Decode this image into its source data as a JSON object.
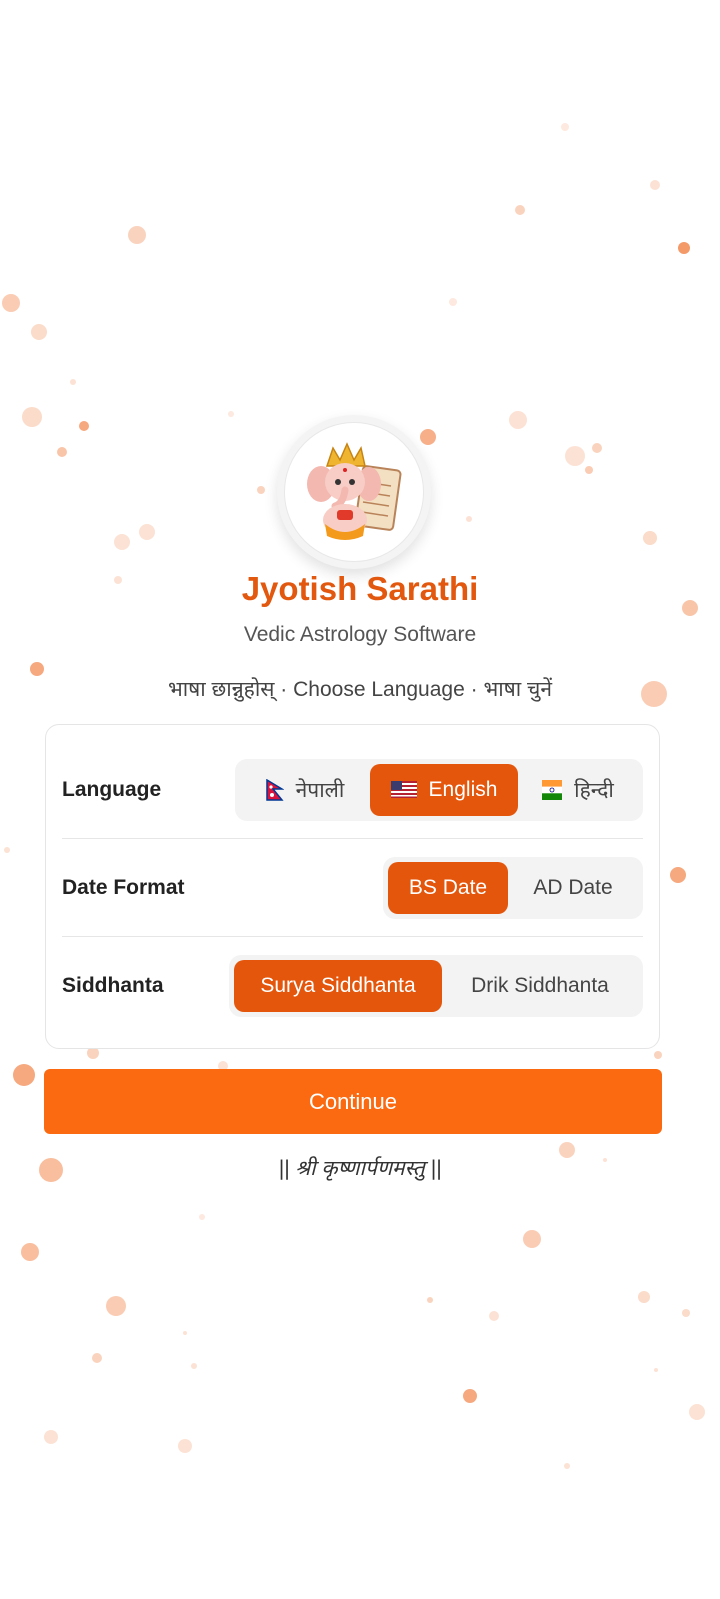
{
  "app": {
    "title": "Jyotish Sarathi",
    "subtitle": "Vedic Astrology Software",
    "choose_language": "भाषा छान्नुहोस् · Choose Language · भाषा चुनें"
  },
  "settings": {
    "language": {
      "label": "Language",
      "options": [
        "नेपाली",
        "English",
        "हिन्दी"
      ],
      "selected": "English"
    },
    "date_format": {
      "label": "Date Format",
      "options": [
        "BS Date",
        "AD Date"
      ],
      "selected": "BS Date"
    },
    "siddhanta": {
      "label": "Siddhanta",
      "options": [
        "Surya Siddhanta",
        "Drik Siddhanta"
      ],
      "selected": "Surya Siddhanta"
    }
  },
  "continue_label": "Continue",
  "footer": "|| श्री कृष्णार्पणमस्तु ||",
  "colors": {
    "accent": "#e4560c",
    "button": "#fb6a10",
    "title": "#e2580f"
  },
  "icons": [
    "ganesha-logo-icon",
    "nepal-flag-icon",
    "us-flag-icon",
    "india-flag-icon"
  ]
}
